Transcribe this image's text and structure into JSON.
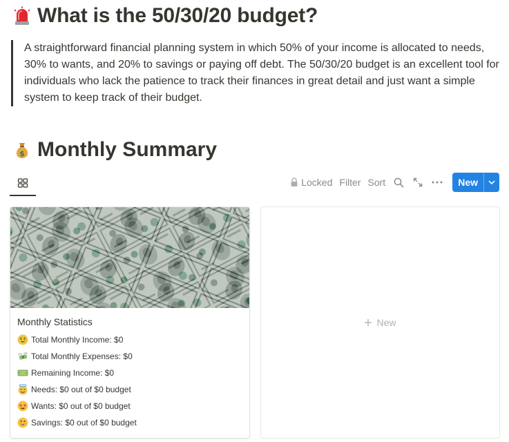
{
  "heading1": {
    "emoji": "siren-emoji",
    "title": "What is the 50/30/20 budget?"
  },
  "quote": {
    "text": "A straightforward financial planning system in which 50% of your income is allocated to needs, 30% to wants, and 20% to savings or paying off debt. The 50/30/20 budget is an excellent tool for individuals who lack the patience to track their finances in great detail and just want a simple system to keep track of their budget."
  },
  "heading2": {
    "emoji": "money-bag-emoji",
    "title": "Monthly Summary"
  },
  "view": {
    "tab_icon": "gallery-grid-icon",
    "toolbar": {
      "locked_label": "Locked",
      "filter_label": "Filter",
      "sort_label": "Sort",
      "search_icon": "search-icon",
      "expand_icon": "expand-icon",
      "more_icon": "more-icon",
      "new_label": "New",
      "new_color": "#2383e2"
    }
  },
  "gallery": {
    "cards": [
      {
        "cover": "dollar-bills-image",
        "title": "Monthly Statistics",
        "stats": [
          {
            "emoji": "money-mouth-face",
            "text": "Total Monthly Income: $0"
          },
          {
            "emoji": "money-with-wings",
            "text": "Total Monthly Expenses: $0"
          },
          {
            "emoji": "dollar-banknote",
            "text": "Remaining Income: $0"
          },
          {
            "emoji": "smiling-face-with-halo",
            "text": "Needs: $0 out of $0 budget"
          },
          {
            "emoji": "star-struck",
            "text": "Wants: $0 out of $0 budget"
          },
          {
            "emoji": "grinning-face",
            "text": "Savings: $0 out of $0 budget"
          }
        ]
      }
    ],
    "add_new_label": "New"
  }
}
